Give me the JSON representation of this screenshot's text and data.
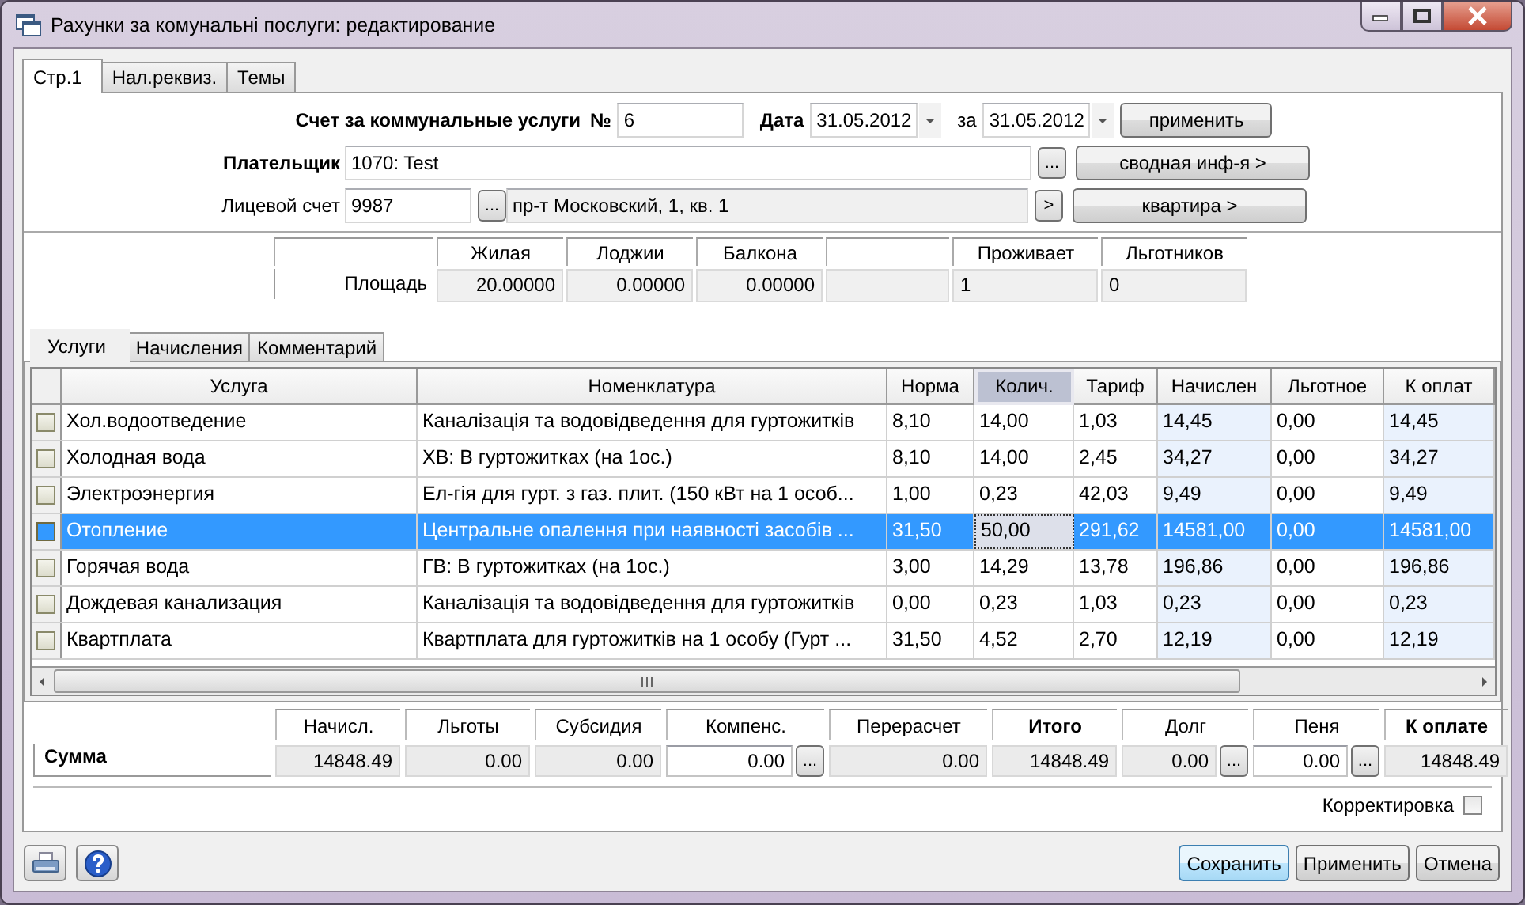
{
  "window": {
    "title": "Рахунки за комунальні послуги: редактирование"
  },
  "tabs": [
    {
      "label": "Стр.1",
      "selected": true
    },
    {
      "label": "Нал.реквиз.",
      "selected": false
    },
    {
      "label": "Темы",
      "selected": false
    }
  ],
  "header": {
    "invoice_label": "Счет за коммунальные услуги",
    "number_label": "№",
    "number": "6",
    "date_label": "Дата",
    "date": "31.05.2012",
    "for_label": "за",
    "for_date": "31.05.2012",
    "apply_button": "применить"
  },
  "payer": {
    "label": "Плательщик",
    "value": "1070: Test",
    "browse_button": "...",
    "summary_button": "сводная инф-я >"
  },
  "account": {
    "label": "Лицевой счет",
    "value": "9987",
    "browse_button": "...",
    "address": "пр-т Московский, 1, кв. 1",
    "go_button": ">",
    "flat_button": "квартира >"
  },
  "area": {
    "row_label": "Площадь",
    "cells": [
      {
        "kind": "measure",
        "heading": "Жилая",
        "value": "20.00000"
      },
      {
        "kind": "measure",
        "heading": "Лоджии",
        "value": "0.00000"
      },
      {
        "kind": "measure",
        "heading": "Балкона",
        "value": "0.00000"
      },
      {
        "kind": "blank"
      },
      {
        "kind": "count",
        "heading": "Проживает",
        "value": "1"
      },
      {
        "kind": "count",
        "heading": "Льготников",
        "value": "0"
      }
    ]
  },
  "inner_tabs": [
    {
      "label": "Услуги",
      "selected": true
    },
    {
      "label": "Начисления",
      "selected": false
    },
    {
      "label": "Комментарий",
      "selected": false
    }
  ],
  "table": {
    "columns": [
      {
        "label": "Услуга",
        "selected": false,
        "shaded": false
      },
      {
        "label": "Номенклатура",
        "selected": false,
        "shaded": false
      },
      {
        "label": "Норма",
        "selected": false,
        "shaded": false
      },
      {
        "label": "Колич.",
        "selected": true,
        "shaded": false
      },
      {
        "label": "Тариф",
        "selected": false,
        "shaded": false
      },
      {
        "label": "Начислен",
        "selected": false,
        "shaded": true
      },
      {
        "label": "Льготное",
        "selected": false,
        "shaded": false
      },
      {
        "label": "К оплат",
        "selected": false,
        "shaded": true
      }
    ],
    "rows": [
      {
        "checked": false,
        "selected": false,
        "cells": [
          "Хол.водоотведение",
          "Каналізація та водовідведення для гуртожитків",
          "8,10",
          "14,00",
          "1,03",
          "14,45",
          "0,00",
          "14,45"
        ]
      },
      {
        "checked": false,
        "selected": false,
        "cells": [
          "Холодная вода",
          "ХВ: В гуртожитках (на 1ос.)",
          "8,10",
          "14,00",
          "2,45",
          "34,27",
          "0,00",
          "34,27"
        ]
      },
      {
        "checked": false,
        "selected": false,
        "cells": [
          "Электроэнергия",
          "Ел-гія для гурт. з газ. плит.  (150 кВт на 1 особ...",
          "1,00",
          "0,23",
          "42,03",
          "9,49",
          "0,00",
          "9,49"
        ]
      },
      {
        "checked": false,
        "selected": true,
        "cells": [
          "Отопление",
          "Центральне опалення при наявності засобів ...",
          "31,50",
          "50,00",
          "291,62",
          "14581,00",
          "0,00",
          "14581,00"
        ]
      },
      {
        "checked": false,
        "selected": false,
        "cells": [
          "Горячая вода",
          "ГВ: В гуртожитках (на 1ос.)",
          "3,00",
          "14,29",
          "13,78",
          "196,86",
          "0,00",
          "196,86"
        ]
      },
      {
        "checked": false,
        "selected": false,
        "cells": [
          "Дождевая канализация",
          "Каналізація та водовідведення для гуртожитків",
          "0,00",
          "0,23",
          "1,03",
          "0,23",
          "0,00",
          "0,23"
        ]
      },
      {
        "checked": false,
        "selected": false,
        "cells": [
          "Квартплата",
          "Квартплата для гуртожитків на 1 особу (Гурт ...",
          "31,50",
          "4,52",
          "2,70",
          "12,19",
          "0,00",
          "12,19"
        ]
      }
    ]
  },
  "totals": {
    "row_label": "Сумма",
    "columns": [
      {
        "heading": "Начисл.",
        "value": "14848.49",
        "bold": false,
        "editable": false
      },
      {
        "heading": "Льготы",
        "value": "0.00",
        "bold": false,
        "editable": false
      },
      {
        "heading": "Субсидия",
        "value": "0.00",
        "bold": false,
        "editable": false
      },
      {
        "heading": "Компенс.",
        "value": "0.00",
        "bold": false,
        "editable": true,
        "button": "..."
      },
      {
        "heading": "Перерасчет",
        "value": "0.00",
        "bold": false,
        "editable": false
      },
      {
        "heading": "Итого",
        "value": "14848.49",
        "bold": true,
        "editable": false
      },
      {
        "heading": "Долг",
        "value": "0.00",
        "bold": false,
        "editable": false,
        "button": "..."
      },
      {
        "heading": "Пеня",
        "value": "0.00",
        "bold": false,
        "editable": true,
        "button": "..."
      },
      {
        "heading": "К оплате",
        "value": "14848.49",
        "bold": true,
        "editable": false
      }
    ]
  },
  "correction": {
    "label": "Корректировка",
    "checked": false
  },
  "buttons": [
    {
      "label": "Сохранить",
      "default": true
    },
    {
      "label": "Применить",
      "default": false
    },
    {
      "label": "Отмена",
      "default": false
    }
  ]
}
